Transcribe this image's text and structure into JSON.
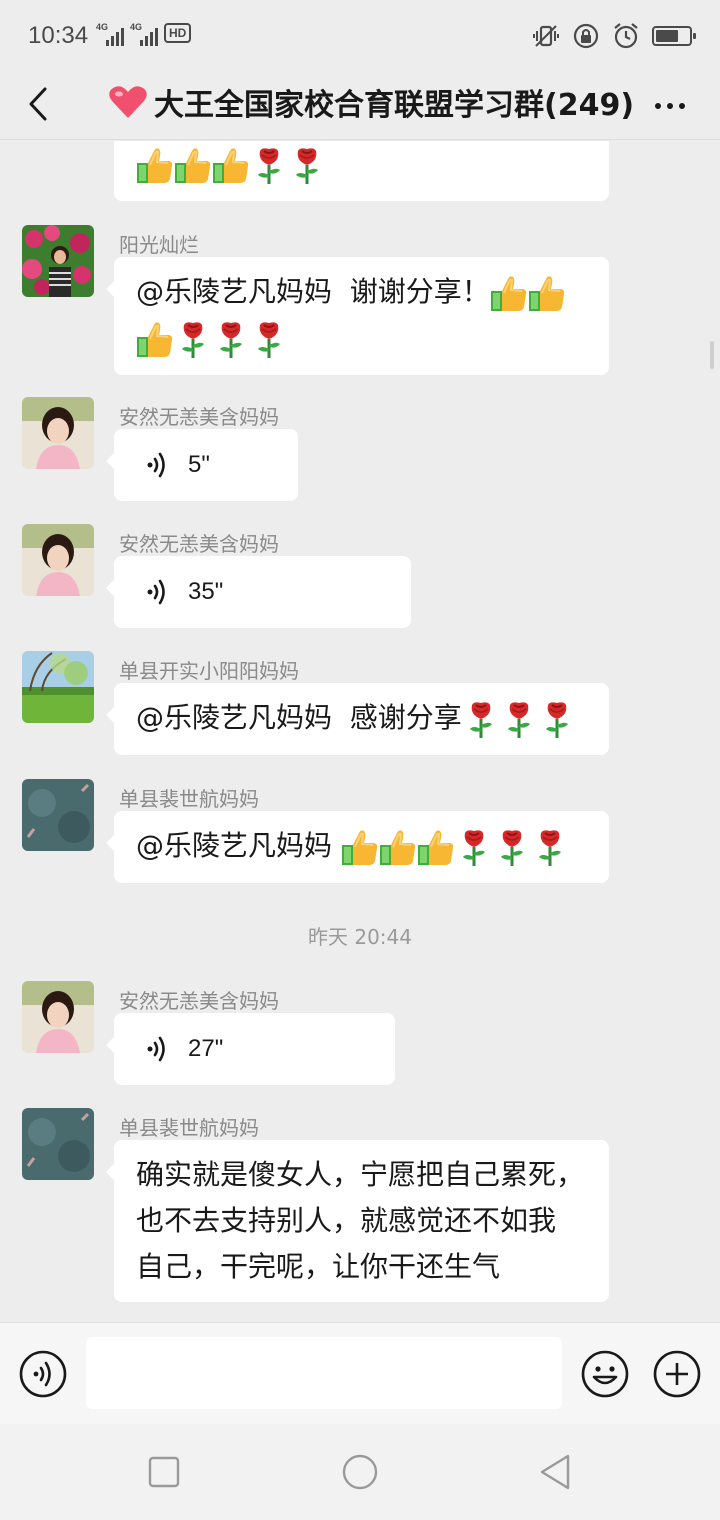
{
  "status_bar": {
    "time": "10:34",
    "network_1": "4G",
    "network_2": "4G",
    "hd_badge": "HD",
    "battery_level": 0.7
  },
  "header": {
    "title": "大王全国家校合育联盟学习群(249)",
    "title_icon": "heart-icon",
    "back_icon": "chevron-left-icon",
    "more_icon": "more-dots-icon"
  },
  "emoji_names": {
    "thumb": "thumbs-up-icon",
    "rose": "rose-icon"
  },
  "messages": [
    {
      "id": 0,
      "sender": "",
      "type": "emoji",
      "emojis": [
        "thumb",
        "thumb",
        "thumb",
        "rose",
        "rose"
      ]
    },
    {
      "id": 1,
      "sender": "阳光灿烂",
      "type": "text",
      "text": "@乐陵艺凡妈妈  谢谢分享！",
      "emojis": [
        "thumb",
        "thumb",
        "thumb",
        "rose",
        "rose",
        "rose"
      ]
    },
    {
      "id": 2,
      "sender": "安然无恙美含妈妈",
      "type": "voice",
      "duration": "5\""
    },
    {
      "id": 3,
      "sender": "安然无恙美含妈妈",
      "type": "voice",
      "duration": "35\""
    },
    {
      "id": 4,
      "sender": "单县开实小阳阳妈妈",
      "type": "text",
      "text": "@乐陵艺凡妈妈  感谢分享",
      "emojis": [
        "rose",
        "rose",
        "rose"
      ]
    },
    {
      "id": 5,
      "sender": "单县裴世航妈妈",
      "type": "text",
      "text": "@乐陵艺凡妈妈 ",
      "emojis": [
        "thumb",
        "thumb",
        "thumb",
        "rose",
        "rose",
        "rose"
      ]
    },
    {
      "id": 6,
      "sender": "安然无恙美含妈妈",
      "type": "voice",
      "duration": "27\""
    },
    {
      "id": 7,
      "sender": "单县裴世航妈妈",
      "type": "text",
      "lines": [
        "确实就是傻女人，宁愿把自己累死，",
        "也不去支持别人，就感觉还不如我",
        "自己，干完呢，让你干还生气"
      ]
    }
  ],
  "time_separator": "昨天 20:44",
  "input_bar": {
    "voice_icon": "voice-mode-icon",
    "emoji_icon": "emoji-icon",
    "plus_icon": "plus-icon",
    "value": ""
  },
  "nav_bar": {
    "recent_icon": "recents-icon",
    "home_icon": "home-icon",
    "back_icon": "back-triangle-icon"
  },
  "colors": {
    "background": "#ededed",
    "bubble": "#ffffff",
    "sender": "#8a8a8a",
    "heart": "#f0506e"
  }
}
